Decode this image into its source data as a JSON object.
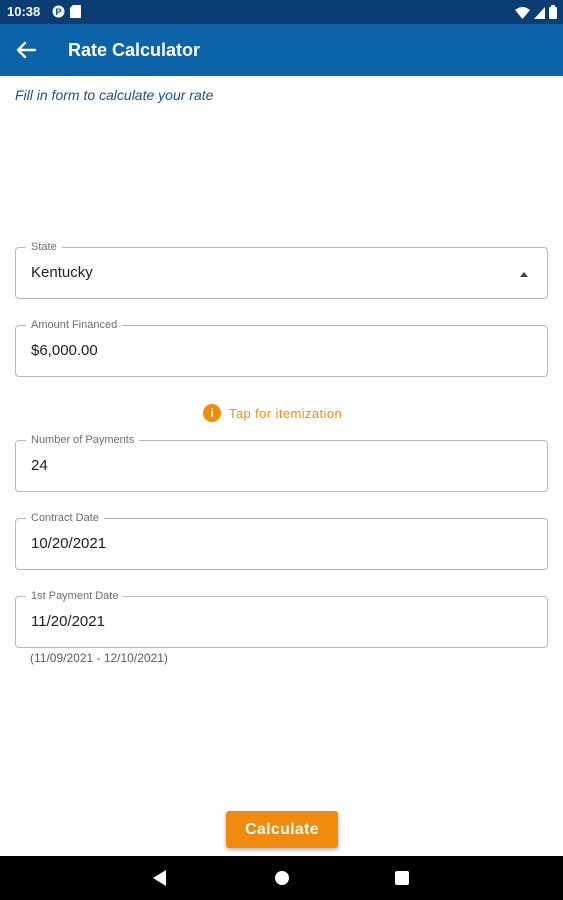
{
  "status_bar": {
    "time": "10:38",
    "left_icons": [
      "notification-icon",
      "sd-card-icon"
    ],
    "right_icons": [
      "wifi-icon",
      "signal-icon",
      "battery-icon"
    ]
  },
  "app_bar": {
    "back_icon": "arrow-back-icon",
    "title": "Rate Calculator"
  },
  "instruction": "Fill in form to calculate your rate",
  "form": {
    "state": {
      "label": "State",
      "value": "Kentucky"
    },
    "amount_financed": {
      "label": "Amount Financed",
      "value": "$6,000.00"
    },
    "itemization": {
      "icon": "info-icon",
      "icon_glyph": "i",
      "label": "Tap for itemization"
    },
    "number_of_payments": {
      "label": "Number of Payments",
      "value": "24"
    },
    "contract_date": {
      "label": "Contract Date",
      "value": "10/20/2021"
    },
    "first_payment_date": {
      "label": "1st Payment Date",
      "value": "11/20/2021",
      "helper": "(11/09/2021 - 12/10/2021)"
    }
  },
  "calculate_label": "Calculate",
  "nav_bar": {
    "icons": [
      "nav-back-icon",
      "nav-home-icon",
      "nav-recents-icon"
    ]
  },
  "colors": {
    "status_bar": "#0a3d73",
    "app_bar": "#0d63a8",
    "accent_orange": "#f0890c",
    "instruction_text": "#1f4f87"
  }
}
